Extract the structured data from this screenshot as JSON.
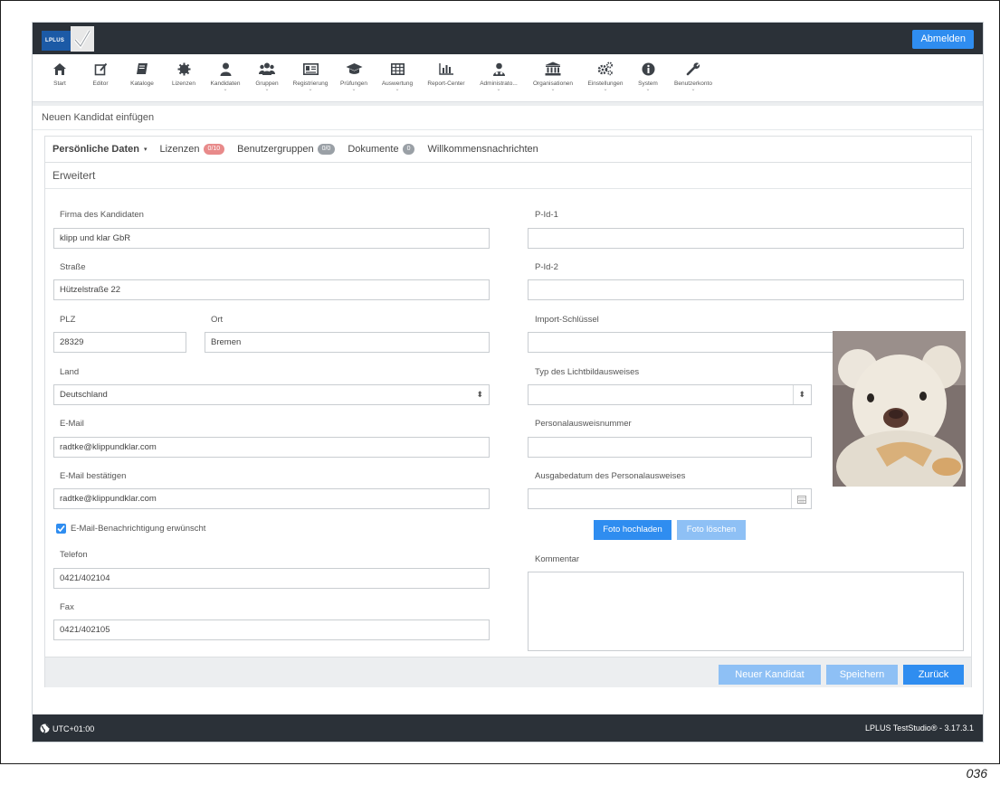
{
  "app": {
    "logo_text": "LPLUS",
    "logout_label": "Abmelden"
  },
  "nav": [
    {
      "label": "Start",
      "icon": "home-icon",
      "caret": false
    },
    {
      "label": "Editor",
      "icon": "edit-icon",
      "caret": false
    },
    {
      "label": "Kataloge",
      "icon": "book-icon",
      "caret": false
    },
    {
      "label": "Lizenzen",
      "icon": "certificate-icon",
      "caret": false
    },
    {
      "label": "Kandidaten",
      "icon": "user-icon",
      "caret": true
    },
    {
      "label": "Gruppen",
      "icon": "users-icon",
      "caret": true
    },
    {
      "label": "Registrierung",
      "icon": "id-card-icon",
      "caret": true
    },
    {
      "label": "Prüfungen",
      "icon": "graduation-cap-icon",
      "caret": true
    },
    {
      "label": "Auswertung",
      "icon": "table-icon",
      "caret": true
    },
    {
      "label": "Report-Center",
      "icon": "bar-chart-icon",
      "caret": false
    },
    {
      "label": "Administrato...",
      "icon": "admin-icon",
      "caret": true
    },
    {
      "label": "Organisationen",
      "icon": "institution-icon",
      "caret": true
    },
    {
      "label": "Einstellungen",
      "icon": "cogs-icon",
      "caret": true
    },
    {
      "label": "System",
      "icon": "info-icon",
      "caret": true
    },
    {
      "label": "Benutzerkonto",
      "icon": "wrench-icon",
      "caret": true
    }
  ],
  "page_title": "Neuen Kandidat einfügen",
  "tabs": {
    "personal": "Persönliche Daten",
    "licenses": "Lizenzen",
    "licenses_badge": "0/10",
    "usergroups": "Benutzergruppen",
    "usergroups_badge": "0/0",
    "documents": "Dokumente",
    "documents_badge": "0",
    "welcome": "Willkommensnachrichten"
  },
  "subtab": "Erweitert",
  "form": {
    "company_label": "Firma des Kandidaten",
    "company_value": "klipp und klar GbR",
    "street_label": "Straße",
    "street_value": "Hützelstraße 22",
    "zip_label": "PLZ",
    "zip_value": "28329",
    "city_label": "Ort",
    "city_value": "Bremen",
    "country_label": "Land",
    "country_value": "Deutschland",
    "email_label": "E-Mail",
    "email_value": "radtke@klippundklar.com",
    "email_confirm_label": "E-Mail bestätigen",
    "email_confirm_value": "radtke@klippundklar.com",
    "notify_label": "E-Mail-Benachrichtigung erwünscht",
    "phone_label": "Telefon",
    "phone_value": "0421/402104",
    "fax_label": "Fax",
    "fax_value": "0421/402105",
    "pid1_label": "P-Id-1",
    "pid2_label": "P-Id-2",
    "import_label": "Import-Schlüssel",
    "idtype_label": "Typ des Lichtbildausweises",
    "idnumber_label": "Personalausweisnummer",
    "iddate_label": "Ausgabedatum des Personalausweises",
    "upload_label": "Foto hochladen",
    "delete_label": "Foto löschen",
    "comment_label": "Kommentar"
  },
  "buttons": {
    "new": "Neuer Kandidat",
    "save": "Speichern",
    "back": "Zurück"
  },
  "status": {
    "timezone": "UTC+01:00",
    "version": "LPLUS TestStudio® - 3.17.3.1"
  },
  "page_number": "036",
  "colors": {
    "primary": "#2f8df0",
    "primary_light": "#8ec0f5",
    "dark_bar": "#2b3138"
  }
}
